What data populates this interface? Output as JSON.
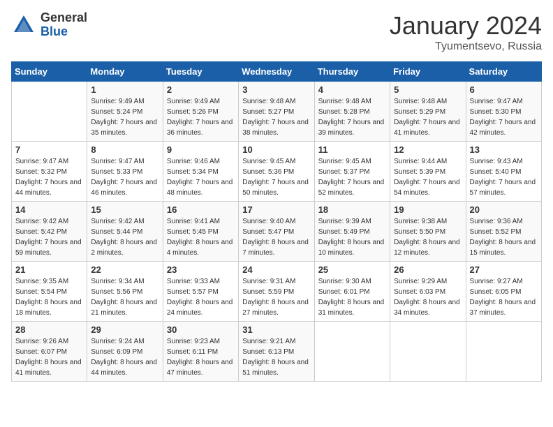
{
  "logo": {
    "general": "General",
    "blue": "Blue"
  },
  "title": "January 2024",
  "location": "Tyumentsevo, Russia",
  "days_of_week": [
    "Sunday",
    "Monday",
    "Tuesday",
    "Wednesday",
    "Thursday",
    "Friday",
    "Saturday"
  ],
  "weeks": [
    [
      {
        "num": "",
        "empty": true
      },
      {
        "num": "1",
        "sunrise": "Sunrise: 9:49 AM",
        "sunset": "Sunset: 5:24 PM",
        "daylight": "Daylight: 7 hours and 35 minutes."
      },
      {
        "num": "2",
        "sunrise": "Sunrise: 9:49 AM",
        "sunset": "Sunset: 5:26 PM",
        "daylight": "Daylight: 7 hours and 36 minutes."
      },
      {
        "num": "3",
        "sunrise": "Sunrise: 9:48 AM",
        "sunset": "Sunset: 5:27 PM",
        "daylight": "Daylight: 7 hours and 38 minutes."
      },
      {
        "num": "4",
        "sunrise": "Sunrise: 9:48 AM",
        "sunset": "Sunset: 5:28 PM",
        "daylight": "Daylight: 7 hours and 39 minutes."
      },
      {
        "num": "5",
        "sunrise": "Sunrise: 9:48 AM",
        "sunset": "Sunset: 5:29 PM",
        "daylight": "Daylight: 7 hours and 41 minutes."
      },
      {
        "num": "6",
        "sunrise": "Sunrise: 9:47 AM",
        "sunset": "Sunset: 5:30 PM",
        "daylight": "Daylight: 7 hours and 42 minutes."
      }
    ],
    [
      {
        "num": "7",
        "sunrise": "Sunrise: 9:47 AM",
        "sunset": "Sunset: 5:32 PM",
        "daylight": "Daylight: 7 hours and 44 minutes."
      },
      {
        "num": "8",
        "sunrise": "Sunrise: 9:47 AM",
        "sunset": "Sunset: 5:33 PM",
        "daylight": "Daylight: 7 hours and 46 minutes."
      },
      {
        "num": "9",
        "sunrise": "Sunrise: 9:46 AM",
        "sunset": "Sunset: 5:34 PM",
        "daylight": "Daylight: 7 hours and 48 minutes."
      },
      {
        "num": "10",
        "sunrise": "Sunrise: 9:45 AM",
        "sunset": "Sunset: 5:36 PM",
        "daylight": "Daylight: 7 hours and 50 minutes."
      },
      {
        "num": "11",
        "sunrise": "Sunrise: 9:45 AM",
        "sunset": "Sunset: 5:37 PM",
        "daylight": "Daylight: 7 hours and 52 minutes."
      },
      {
        "num": "12",
        "sunrise": "Sunrise: 9:44 AM",
        "sunset": "Sunset: 5:39 PM",
        "daylight": "Daylight: 7 hours and 54 minutes."
      },
      {
        "num": "13",
        "sunrise": "Sunrise: 9:43 AM",
        "sunset": "Sunset: 5:40 PM",
        "daylight": "Daylight: 7 hours and 57 minutes."
      }
    ],
    [
      {
        "num": "14",
        "sunrise": "Sunrise: 9:42 AM",
        "sunset": "Sunset: 5:42 PM",
        "daylight": "Daylight: 7 hours and 59 minutes."
      },
      {
        "num": "15",
        "sunrise": "Sunrise: 9:42 AM",
        "sunset": "Sunset: 5:44 PM",
        "daylight": "Daylight: 8 hours and 2 minutes."
      },
      {
        "num": "16",
        "sunrise": "Sunrise: 9:41 AM",
        "sunset": "Sunset: 5:45 PM",
        "daylight": "Daylight: 8 hours and 4 minutes."
      },
      {
        "num": "17",
        "sunrise": "Sunrise: 9:40 AM",
        "sunset": "Sunset: 5:47 PM",
        "daylight": "Daylight: 8 hours and 7 minutes."
      },
      {
        "num": "18",
        "sunrise": "Sunrise: 9:39 AM",
        "sunset": "Sunset: 5:49 PM",
        "daylight": "Daylight: 8 hours and 10 minutes."
      },
      {
        "num": "19",
        "sunrise": "Sunrise: 9:38 AM",
        "sunset": "Sunset: 5:50 PM",
        "daylight": "Daylight: 8 hours and 12 minutes."
      },
      {
        "num": "20",
        "sunrise": "Sunrise: 9:36 AM",
        "sunset": "Sunset: 5:52 PM",
        "daylight": "Daylight: 8 hours and 15 minutes."
      }
    ],
    [
      {
        "num": "21",
        "sunrise": "Sunrise: 9:35 AM",
        "sunset": "Sunset: 5:54 PM",
        "daylight": "Daylight: 8 hours and 18 minutes."
      },
      {
        "num": "22",
        "sunrise": "Sunrise: 9:34 AM",
        "sunset": "Sunset: 5:56 PM",
        "daylight": "Daylight: 8 hours and 21 minutes."
      },
      {
        "num": "23",
        "sunrise": "Sunrise: 9:33 AM",
        "sunset": "Sunset: 5:57 PM",
        "daylight": "Daylight: 8 hours and 24 minutes."
      },
      {
        "num": "24",
        "sunrise": "Sunrise: 9:31 AM",
        "sunset": "Sunset: 5:59 PM",
        "daylight": "Daylight: 8 hours and 27 minutes."
      },
      {
        "num": "25",
        "sunrise": "Sunrise: 9:30 AM",
        "sunset": "Sunset: 6:01 PM",
        "daylight": "Daylight: 8 hours and 31 minutes."
      },
      {
        "num": "26",
        "sunrise": "Sunrise: 9:29 AM",
        "sunset": "Sunset: 6:03 PM",
        "daylight": "Daylight: 8 hours and 34 minutes."
      },
      {
        "num": "27",
        "sunrise": "Sunrise: 9:27 AM",
        "sunset": "Sunset: 6:05 PM",
        "daylight": "Daylight: 8 hours and 37 minutes."
      }
    ],
    [
      {
        "num": "28",
        "sunrise": "Sunrise: 9:26 AM",
        "sunset": "Sunset: 6:07 PM",
        "daylight": "Daylight: 8 hours and 41 minutes."
      },
      {
        "num": "29",
        "sunrise": "Sunrise: 9:24 AM",
        "sunset": "Sunset: 6:09 PM",
        "daylight": "Daylight: 8 hours and 44 minutes."
      },
      {
        "num": "30",
        "sunrise": "Sunrise: 9:23 AM",
        "sunset": "Sunset: 6:11 PM",
        "daylight": "Daylight: 8 hours and 47 minutes."
      },
      {
        "num": "31",
        "sunrise": "Sunrise: 9:21 AM",
        "sunset": "Sunset: 6:13 PM",
        "daylight": "Daylight: 8 hours and 51 minutes."
      },
      {
        "num": "",
        "empty": true
      },
      {
        "num": "",
        "empty": true
      },
      {
        "num": "",
        "empty": true
      }
    ]
  ]
}
